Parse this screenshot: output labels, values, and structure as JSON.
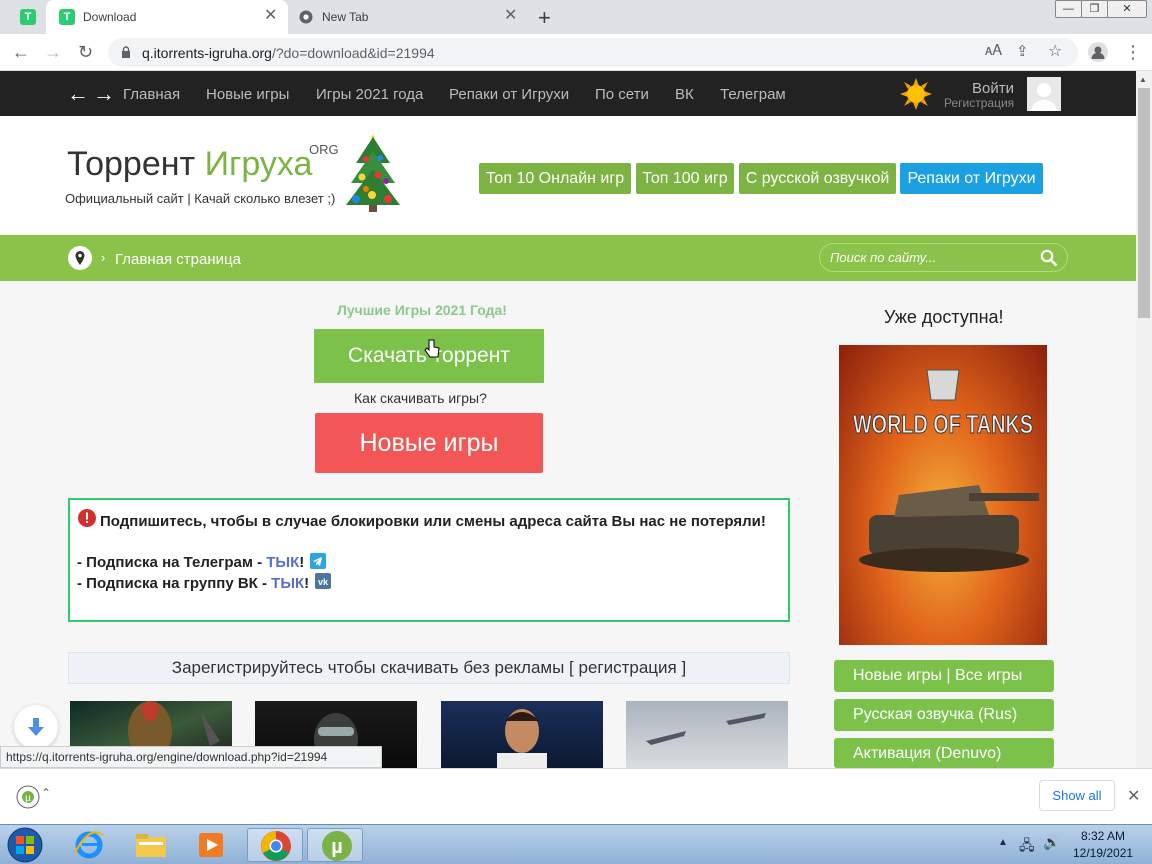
{
  "browser": {
    "tabs": [
      {
        "title": "Download",
        "active": true
      },
      {
        "title": "New Tab",
        "active": false
      }
    ],
    "new_tab": "+",
    "url_host": "q.itorrents-igruha.org",
    "url_rest": "/?do=download&id=21994"
  },
  "site_nav": {
    "items": [
      "Главная",
      "Новые игры",
      "Игры 2021 года",
      "Репаки от Игрухи",
      "По сети",
      "ВК",
      "Телеграм"
    ],
    "login": "Войти",
    "register": "Регистрация"
  },
  "header": {
    "logo_word1": "Торрент",
    "logo_word2": "Игруха",
    "logo_suffix": "ORG",
    "tagline": "Официальный сайт | Качай сколько влезет ;)",
    "buttons": [
      "Топ 10 Онлайн игр",
      "Топ 100 игр",
      "С русской озвучкой",
      "Репаки от Игрухи"
    ]
  },
  "breadcrumb": {
    "label": "Главная страница",
    "search_placeholder": "Поиск по сайту..."
  },
  "main": {
    "best_games": "Лучшие Игры 2021 Года!",
    "download_button": "Скачать торрент",
    "how_to": "Как скачивать игры?",
    "new_games_button": "Новые игры",
    "notice": {
      "headline": "Подпишитесь, чтобы в случае блокировки или смены адреса сайта Вы нас не потеряли!",
      "telegram_prefix": "- Подписка на Телеграм - ",
      "vk_prefix": "- Подписка на группу ВК - ",
      "link": "ТЫК",
      "exclaim": "!"
    },
    "register_bar": "Зарегистрируйтесь чтобы скачивать без рекламы [ регистрация ]"
  },
  "sidebar": {
    "available_title": "Уже доступна!",
    "poster_text": "WORLD OF TANKS",
    "buttons": [
      "Новые игры | Все игры",
      "Русская озвучка (Rus)",
      "Активация (Denuvo)"
    ]
  },
  "status_url": "https://q.itorrents-igruha.org/engine/download.php?id=21994",
  "download_shelf": {
    "show_all": "Show all"
  },
  "taskbar": {
    "time": "8:32 AM",
    "date": "12/19/2021"
  }
}
